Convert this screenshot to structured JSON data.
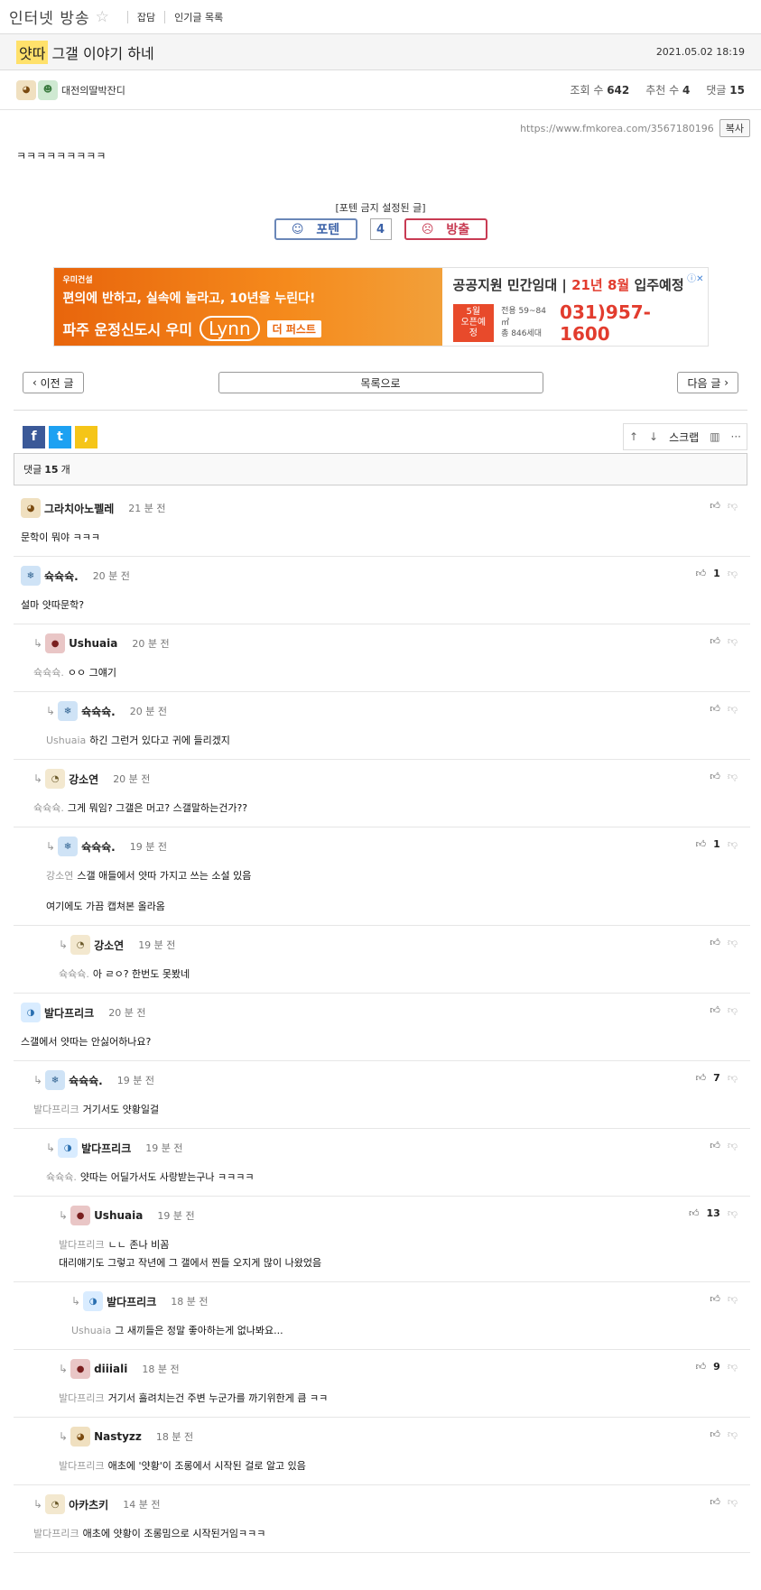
{
  "board": {
    "title": "인터넷 방송",
    "star_icon": "star-outline-icon",
    "links": [
      "잡담",
      "인기글 목록"
    ]
  },
  "post": {
    "category": "얏따",
    "title": "그갤 이야기 하네",
    "date": "2021.05.02 18:19",
    "author": "대전의딸박잔디",
    "views_label": "조회 수",
    "views": "642",
    "recommend_label": "추천 수",
    "recommend": "4",
    "comments_label": "댓글",
    "comments": "15",
    "url": "https://www.fmkorea.com/3567180196",
    "copy_label": "복사",
    "body": "ㅋㅋㅋㅋㅋㅋㅋㅋㅋ"
  },
  "vote": {
    "note": "[포텐 금지 설정된 글]",
    "up_label": "포텐",
    "count": "4",
    "down_label": "방출"
  },
  "ad": {
    "brand": "우미건설",
    "line1": "편의에 반하고, 실속에 놀라고, 10년을 누린다!",
    "line2_a": "파주 운정신도시 우미",
    "line2_lynn": "Lynn",
    "line2_tag": "더 퍼스트",
    "r1_a": "공공지원 민간임대",
    "r1_b": "21년 8월",
    "r1_c": "입주예정",
    "open_a": "5월",
    "open_b": "오픈예정",
    "sub_a": "전용 59~84㎡",
    "sub_b": "총 846세대",
    "phone": "031)957-1600",
    "info_icon": "ad-info-icon"
  },
  "nav": {
    "prev": "이전 글",
    "list": "목록으로",
    "next": "다음 글"
  },
  "tools": {
    "scrap": "스크랩",
    "more": "···"
  },
  "comment_header": {
    "label": "댓글",
    "count": "15",
    "unit": "개"
  },
  "comments": [
    {
      "name": "그라치아노펠레",
      "time": "21 분 전",
      "mention": "",
      "text": "문학이 뭐야 ㅋㅋㅋ",
      "text2": "",
      "likes": "",
      "avatar": "dog"
    },
    {
      "name": "슉슉슉.",
      "time": "20 분 전",
      "mention": "",
      "text": "설마 얏따문학?",
      "text2": "",
      "likes": "1",
      "avatar": "ice"
    },
    {
      "name": "Ushuaia",
      "time": "20 분 전",
      "mention": "슉슉슉.",
      "text": "ㅇㅇ 그얘기",
      "text2": "",
      "likes": "",
      "avatar": "seal"
    },
    {
      "name": "슉슉슉.",
      "time": "20 분 전",
      "mention": "Ushuaia",
      "text": "하긴 그런거 있다고 귀에 들리겠지",
      "text2": "",
      "likes": "",
      "avatar": "ice"
    },
    {
      "name": "강소연",
      "time": "20 분 전",
      "mention": "슉슉슉.",
      "text": "그게 뭐임? 그갤은 머고? 스갤말하는건가??",
      "text2": "",
      "likes": "",
      "avatar": "puff"
    },
    {
      "name": "슉슉슉.",
      "time": "19 분 전",
      "mention": "강소연",
      "text": "스갤 애들에서 얏따 가지고 쓰는 소설 있음",
      "text2": "여기에도 가끔 캡쳐본 올라옴",
      "likes": "1",
      "avatar": "ice"
    },
    {
      "name": "강소연",
      "time": "19 분 전",
      "mention": "슉슉슉.",
      "text": "아 ㄹㅇ? 한번도 못봤네",
      "text2": "",
      "likes": "",
      "avatar": "puff"
    },
    {
      "name": "발다프리크",
      "time": "20 분 전",
      "mention": "",
      "text": "스갤에서 얏따는 안싫어하나요?",
      "text2": "",
      "likes": "",
      "avatar": "blue"
    },
    {
      "name": "슉슉슉.",
      "time": "19 분 전",
      "mention": "발다프리크",
      "text": "거기서도 얏황일걸",
      "text2": "",
      "likes": "7",
      "avatar": "ice"
    },
    {
      "name": "발다프리크",
      "time": "19 분 전",
      "mention": "슉슉슉.",
      "text": "얏따는 어딜가서도 사랑받는구나 ㅋㅋㅋㅋ",
      "text2": "",
      "likes": "",
      "avatar": "blue"
    },
    {
      "name": "Ushuaia",
      "time": "19 분 전",
      "mention": "발다프리크",
      "text": "ㄴㄴ 존나 비꼼",
      "text2": "대리얘기도 그렇고 작년에 그 갤에서 찐들 오지게 많이 나왔었음",
      "likes": "13",
      "avatar": "seal"
    },
    {
      "name": "발다프리크",
      "time": "18 분 전",
      "mention": "Ushuaia",
      "text": "그 새끼들은 정말 좋아하는게 없나봐요...",
      "text2": "",
      "likes": "",
      "avatar": "blue"
    },
    {
      "name": "diiiali",
      "time": "18 분 전",
      "mention": "발다프리크",
      "text": "거기서 흘려치는건 주변 누군가를 까기위한게 큼 ㅋㅋ",
      "text2": "",
      "likes": "9",
      "avatar": "seal"
    },
    {
      "name": "Nastyzz",
      "time": "18 분 전",
      "mention": "발다프리크",
      "text": "애초에 '얏황'이 조롱에서 시작된 걸로 알고 있음",
      "text2": "",
      "likes": "",
      "avatar": "dog"
    },
    {
      "name": "아카츠키",
      "time": "14 분 전",
      "mention": "발다프리크",
      "text": "애초에 얏황이 조롱밈으로 시작된거임ㅋㅋㅋ",
      "text2": "",
      "likes": "",
      "avatar": "puff"
    }
  ]
}
